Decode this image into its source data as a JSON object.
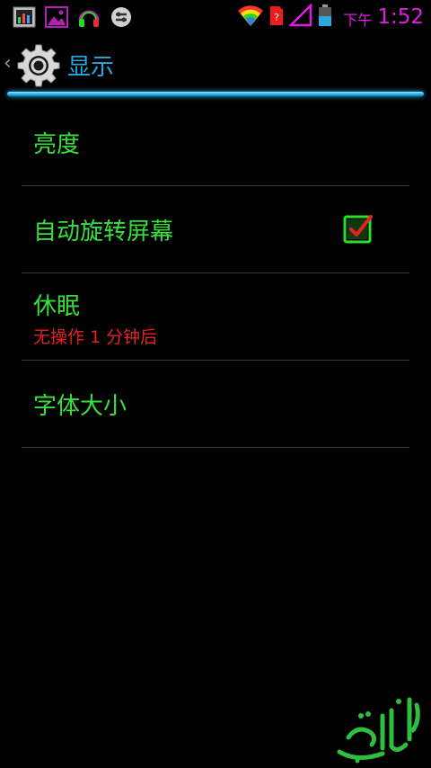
{
  "status_bar": {
    "ampm": "下午",
    "time": "1:52",
    "left_icons": [
      "task-manager-icon",
      "gallery-icon",
      "music-headphones-icon",
      "usb-settings-icon"
    ],
    "right_icons": [
      "wifi-icon",
      "sim-unknown-icon",
      "signal-icon",
      "battery-icon"
    ],
    "accent_color": "#e21be2"
  },
  "action_bar": {
    "back_glyph": "‹",
    "title": "显示",
    "title_color": "#27a8e0"
  },
  "settings": {
    "items": [
      {
        "title": "亮度"
      },
      {
        "title": "自动旋转屏幕",
        "checked": true
      },
      {
        "title": "休眠",
        "summary": "无操作 1 分钟后"
      },
      {
        "title": "字体大小"
      }
    ],
    "title_color": "#36e03b",
    "summary_color": "#e52222"
  }
}
